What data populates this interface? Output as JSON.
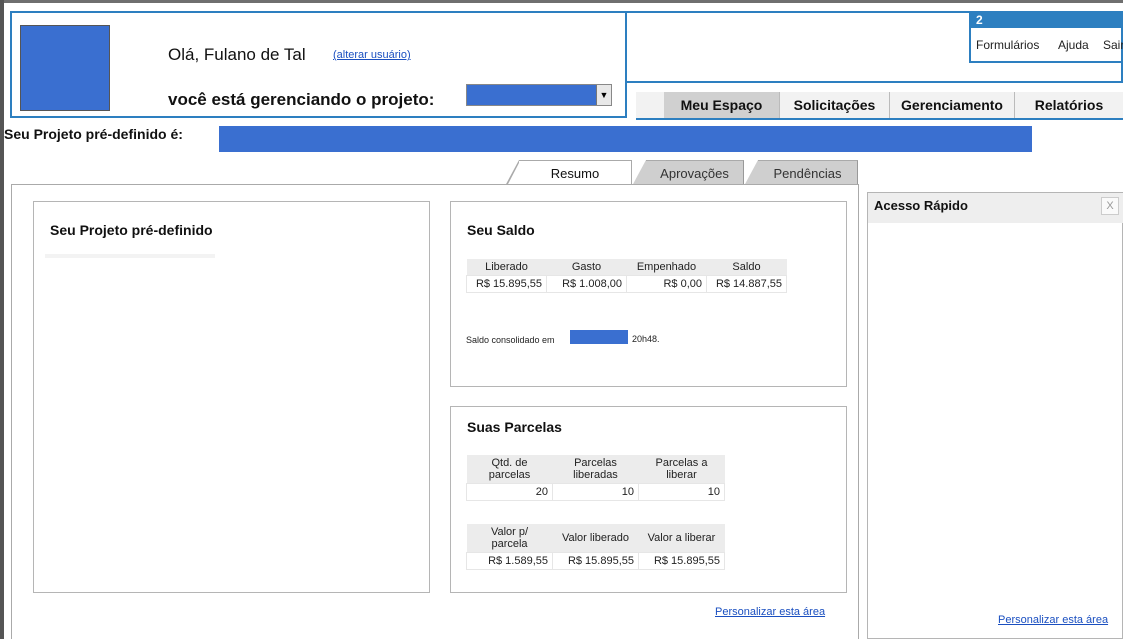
{
  "header": {
    "badge_number": "2",
    "user_menu": [
      "Formulários",
      "Ajuda",
      "Sair"
    ],
    "greeting": "Olá, Fulano de Tal",
    "change_user_link": "(alterar usuário)",
    "managing_label": "você está gerenciando o projeto:",
    "select_arrow": "▼"
  },
  "nav": {
    "items": [
      {
        "label": "Meu Espaço",
        "active": true
      },
      {
        "label": "Solicitações",
        "active": false
      },
      {
        "label": "Gerenciamento",
        "active": false
      },
      {
        "label": "Relatórios",
        "active": false
      }
    ]
  },
  "project": {
    "label": "Seu Projeto pré-definido é:"
  },
  "tabs": [
    "Resumo",
    "Aprovações",
    "Pendências"
  ],
  "left_box": {
    "title": "Seu Projeto pré-definido"
  },
  "saldo": {
    "title": "Seu Saldo",
    "headers": [
      "Liberado",
      "Gasto",
      "Empenhado",
      "Saldo"
    ],
    "values": [
      "R$ 15.895,55",
      "R$ 1.008,00",
      "R$ 0,00",
      "R$ 14.887,55"
    ],
    "note": "Saldo consolidado em",
    "time": "20h48."
  },
  "parcelas": {
    "title": "Suas Parcelas",
    "headers1": [
      "Qtd. de parcelas",
      "Parcelas liberadas",
      "Parcelas a liberar"
    ],
    "values1": [
      "20",
      "10",
      "10"
    ],
    "headers2": [
      "Valor p/ parcela",
      "Valor liberado",
      "Valor a liberar"
    ],
    "values2": [
      "R$ 1.589,55",
      "R$ 15.895,55",
      "R$ 15.895,55"
    ]
  },
  "customize_link": "Personalizar esta área",
  "acesso_rapido": {
    "title": "Acesso Rápido",
    "close": "X",
    "customize_link": "Personalizar esta área"
  },
  "colors": {
    "accent": "#2d7fc0",
    "placeholder_blue": "#3a6fd0",
    "link": "#1a4fc0"
  }
}
